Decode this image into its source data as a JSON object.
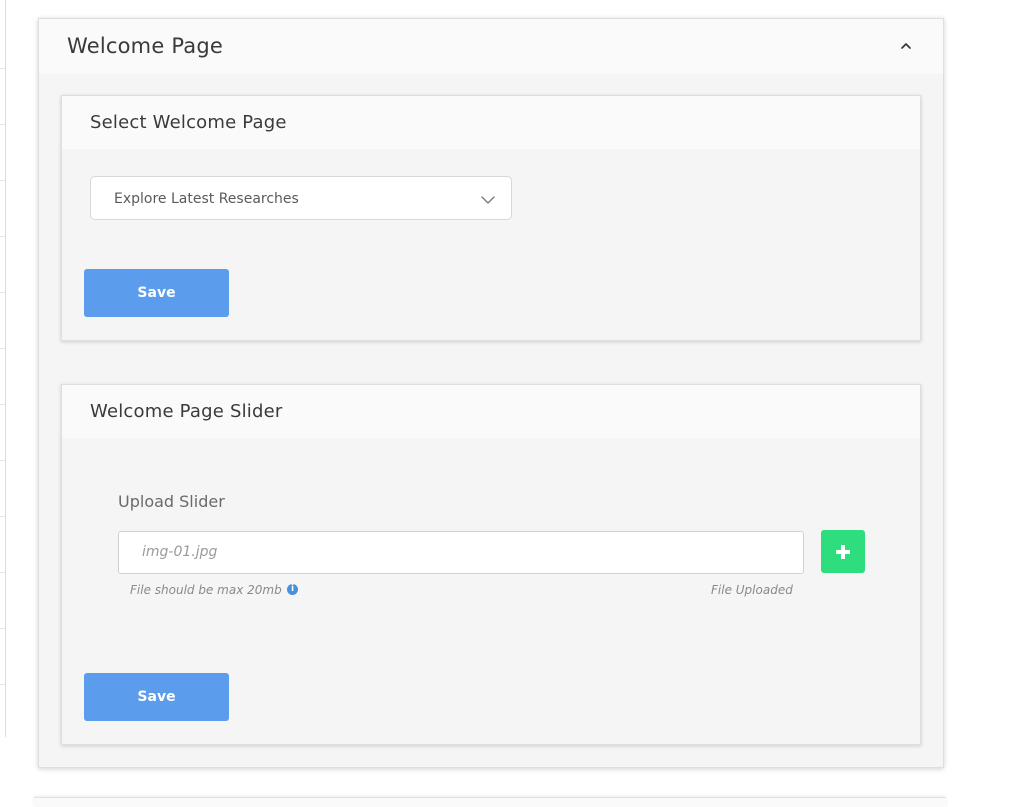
{
  "welcome_page": {
    "title": "Welcome Page"
  },
  "select_section": {
    "title": "Select Welcome Page",
    "selected_value": "Explore Latest Researches",
    "save_label": "Save"
  },
  "slider_section": {
    "title": "Welcome Page Slider",
    "upload_label": "Upload Slider",
    "file_value": "img-01.jpg",
    "size_hint": "File should be max 20mb",
    "upload_status": "File Uploaded",
    "save_label": "Save"
  },
  "icons": {
    "collapse": "chevron-up-icon",
    "dropdown": "chevron-down-icon",
    "add": "plus-icon",
    "info": "info-icon"
  },
  "colors": {
    "save_button": "#5b9cec",
    "add_button": "#2ede7e",
    "info_icon": "#4a90d9"
  }
}
